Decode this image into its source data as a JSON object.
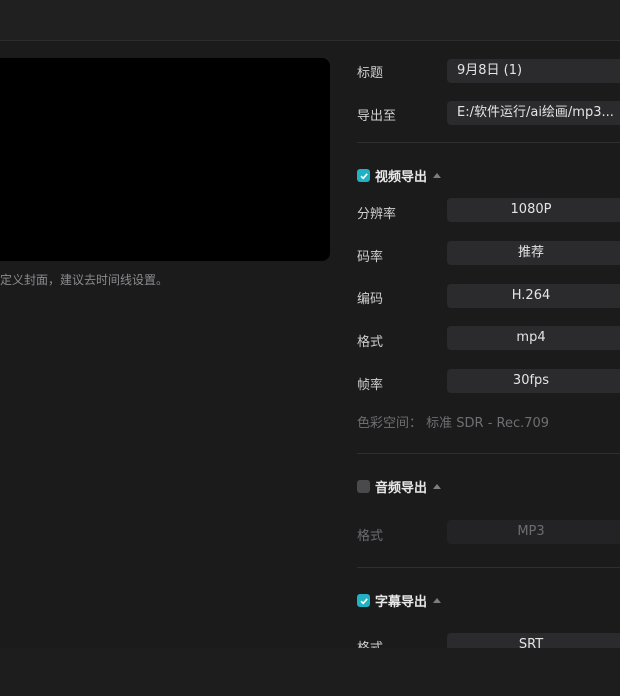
{
  "preview": {
    "cover_hint": "定义封面，建议去时间线设置。"
  },
  "form": {
    "title_label": "标题",
    "title_value": "9月8日 (1)",
    "export_to_label": "导出至",
    "export_to_value": "E:/软件运行/ai绘画/mp3..."
  },
  "video_export": {
    "header": "视频导出",
    "checked": true,
    "resolution_label": "分辨率",
    "resolution_value": "1080P",
    "bitrate_label": "码率",
    "bitrate_value": "推荐",
    "codec_label": "编码",
    "codec_value": "H.264",
    "format_label": "格式",
    "format_value": "mp4",
    "framerate_label": "帧率",
    "framerate_value": "30fps",
    "color_space": "色彩空间：  标准 SDR - Rec.709"
  },
  "audio_export": {
    "header": "音频导出",
    "checked": false,
    "format_label": "格式",
    "format_value": "MP3"
  },
  "subtitle_export": {
    "header": "字幕导出",
    "checked": true,
    "format_label": "格式",
    "format_value": "SRT"
  },
  "colors": {
    "accent": "#20b2c2",
    "background": "#1b1b1c",
    "field": "#2b2b2d"
  },
  "icons": {
    "check": "check-icon",
    "caret": "caret-up-icon"
  }
}
